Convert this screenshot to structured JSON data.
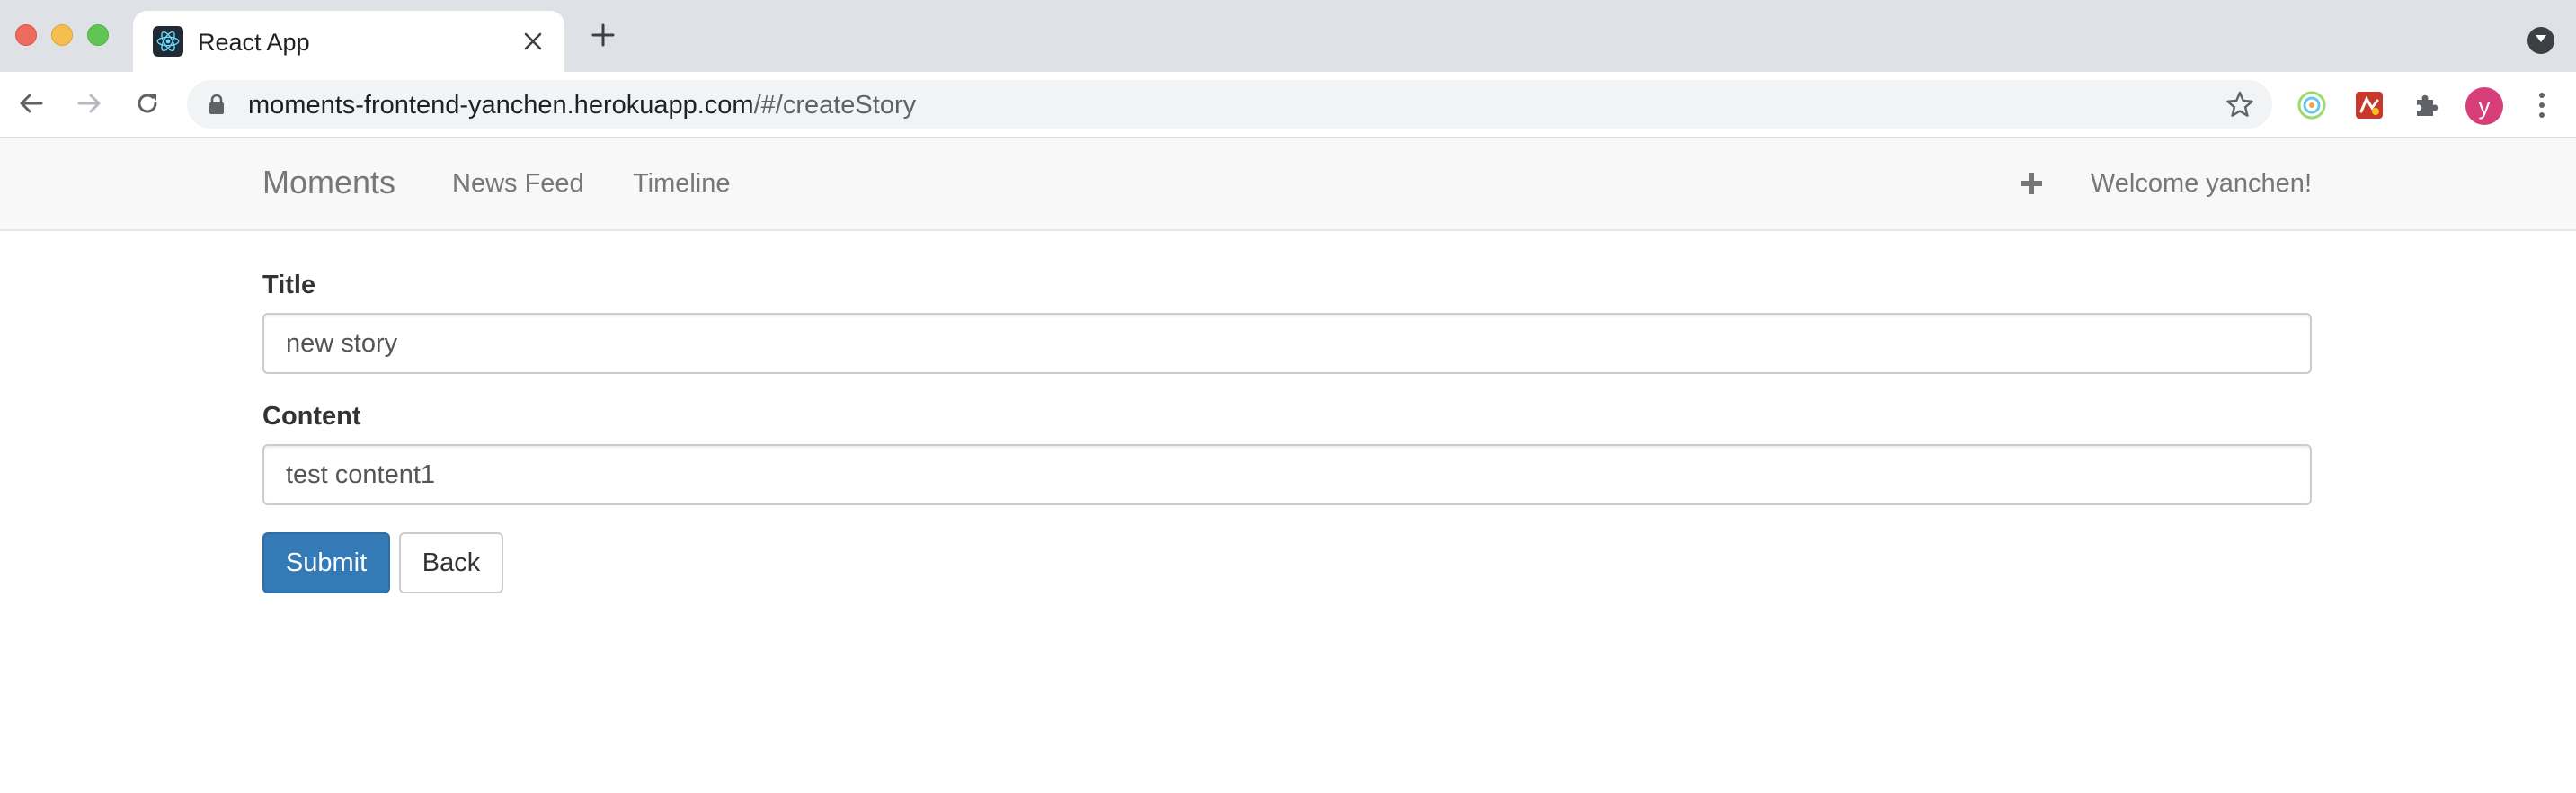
{
  "browser": {
    "tab_title": "React App",
    "url_host": "moments-frontend-yanchen.herokuapp.com",
    "url_path": "/#/createStory",
    "profile_initial": "y",
    "icons": {
      "favicon": "react-logo-icon",
      "tab_close": "close-icon",
      "new_tab": "plus-icon",
      "tab_search": "chevron-down-icon",
      "back": "arrow-left-icon",
      "forward": "arrow-right-icon",
      "reload": "reload-icon",
      "secure": "lock-icon",
      "bookmark": "star-icon",
      "extension_1": "circle-extension-icon",
      "extension_2": "red-extension-icon",
      "extensions": "puzzle-icon",
      "menu": "kebab-menu-icon"
    },
    "colors": {
      "avatar": "#d63e7a",
      "tabstrip": "#dee1e6"
    }
  },
  "navbar": {
    "brand": "Moments",
    "links": [
      "News Feed",
      "Timeline"
    ],
    "create_icon": "plus-icon",
    "welcome": "Welcome yanchen!"
  },
  "form": {
    "title_label": "Title",
    "title_value": "new story",
    "content_label": "Content",
    "content_value": "test content1",
    "submit_label": "Submit",
    "back_label": "Back",
    "colors": {
      "primary": "#337ab7"
    }
  }
}
